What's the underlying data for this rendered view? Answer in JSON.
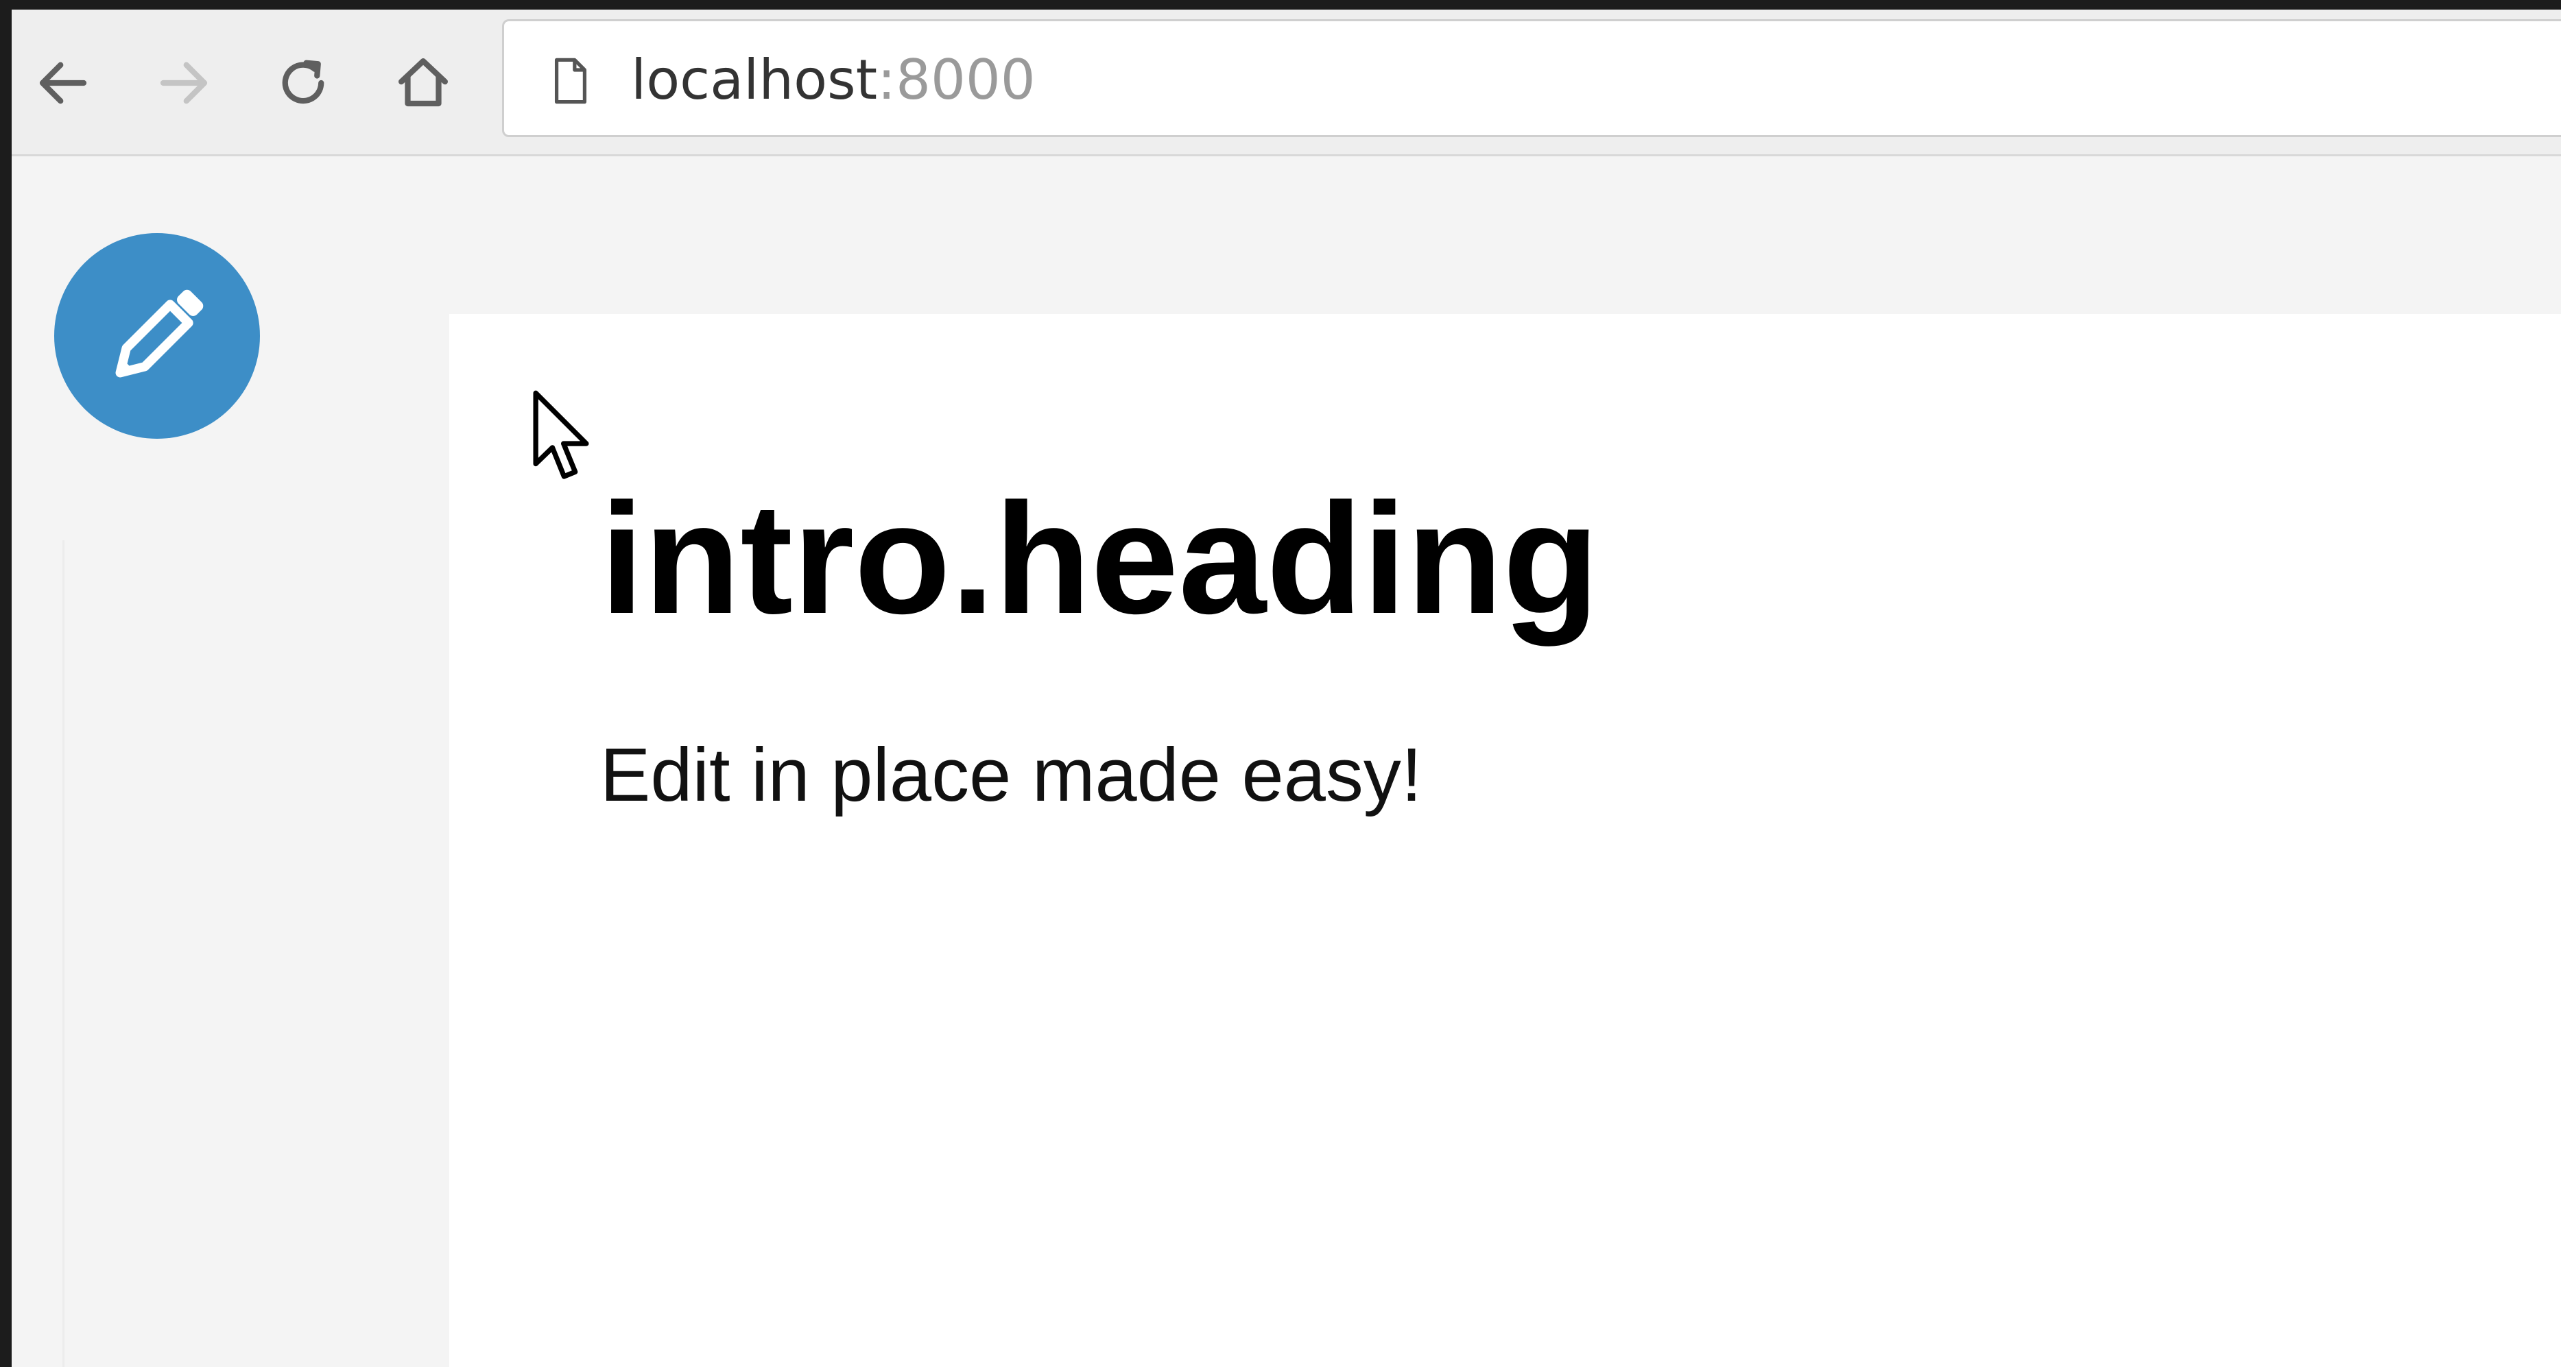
{
  "browser": {
    "url_host": "localhost",
    "url_port": ":8000",
    "icons": {
      "back": "arrow-left-icon",
      "forward": "arrow-right-icon",
      "reload": "reload-icon",
      "home": "home-icon",
      "page": "page-icon"
    },
    "forward_enabled": false
  },
  "page": {
    "heading": "intro.heading",
    "subtext": "Edit in place made easy!",
    "edit_button_icon": "pencil-icon",
    "accent_color": "#3d8ec7"
  }
}
